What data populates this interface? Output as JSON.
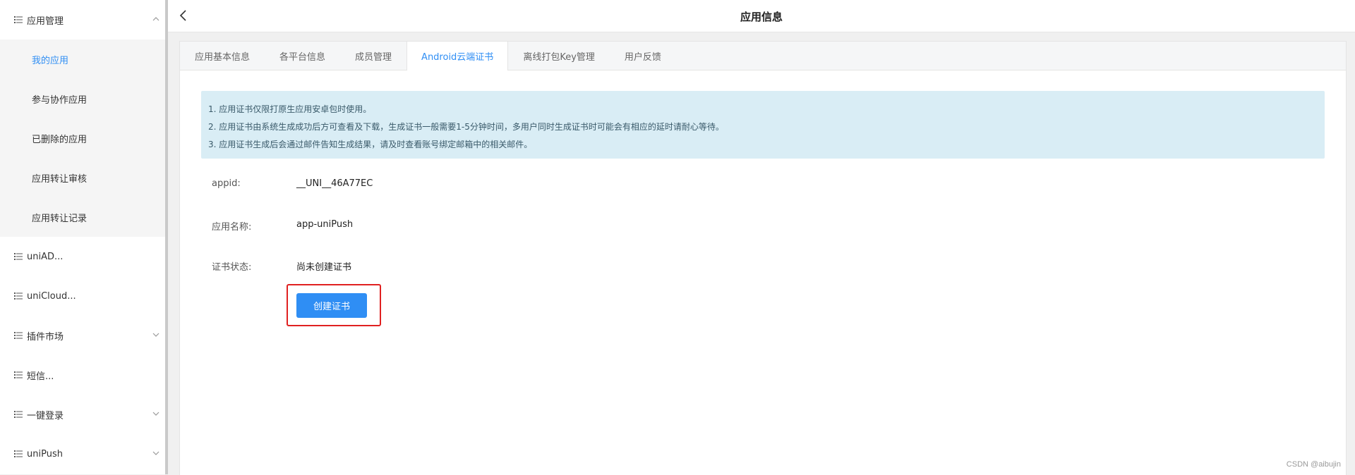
{
  "sidebar": {
    "groups": [
      {
        "label": "应用管理",
        "expanded": true
      },
      {
        "label": "uniAD..."
      },
      {
        "label": "uniCloud..."
      },
      {
        "label": "插件市场",
        "expandable": true
      },
      {
        "label": "短信..."
      },
      {
        "label": "一键登录",
        "expandable": true
      },
      {
        "label": "uniPush",
        "expandable": true
      }
    ],
    "app_items": [
      "我的应用",
      "参与协作应用",
      "已删除的应用",
      "应用转让审核",
      "应用转让记录"
    ],
    "active_item": "我的应用"
  },
  "header": {
    "title": "应用信息"
  },
  "tabs": [
    {
      "label": "应用基本信息"
    },
    {
      "label": "各平台信息"
    },
    {
      "label": "成员管理"
    },
    {
      "label": "Android云端证书",
      "active": true
    },
    {
      "label": "离线打包Key管理"
    },
    {
      "label": "用户反馈"
    }
  ],
  "notice": {
    "lines": [
      "1. 应用证书仅限打原生应用安卓包时使用。",
      "2. 应用证书由系统生成成功后方可查看及下载，生成证书一般需要1-5分钟时间，多用户同时生成证书时可能会有相应的延时请耐心等待。",
      "3. 应用证书生成后会通过邮件告知生成结果，请及时查看账号绑定邮箱中的相关邮件。"
    ]
  },
  "fields": {
    "appid": {
      "label": "appid:",
      "value": "__UNI__46A77EC"
    },
    "app_name": {
      "label": "应用名称:",
      "value": "app-uniPush"
    },
    "cert_status": {
      "label": "证书状态:",
      "value": "尚未创建证书"
    }
  },
  "create_button": {
    "label": "创建证书"
  },
  "watermark": "CSDN @aibujin",
  "colors": {
    "accent": "#2f8ef4",
    "notice_bg": "#d9edf5",
    "highlight": "#e02020"
  }
}
